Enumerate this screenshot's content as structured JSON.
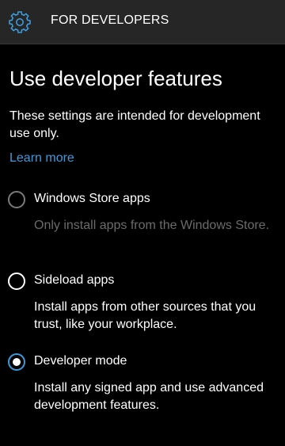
{
  "header": {
    "title": "FOR DEVELOPERS",
    "icon": "gear-icon",
    "accent_color": "#3a9bdc"
  },
  "main": {
    "heading": "Use developer features",
    "description": "These settings are intended for development use only.",
    "learn_more": "Learn more"
  },
  "options": [
    {
      "label": "Windows Store apps",
      "description": "Only install apps from the Windows Store.",
      "selected": false,
      "disabled": true
    },
    {
      "label": "Sideload apps",
      "description": "Install apps from other sources that you trust, like your workplace.",
      "selected": false,
      "disabled": false
    },
    {
      "label": "Developer mode",
      "description": "Install any signed app and use advanced development features.",
      "selected": true,
      "disabled": false
    }
  ]
}
